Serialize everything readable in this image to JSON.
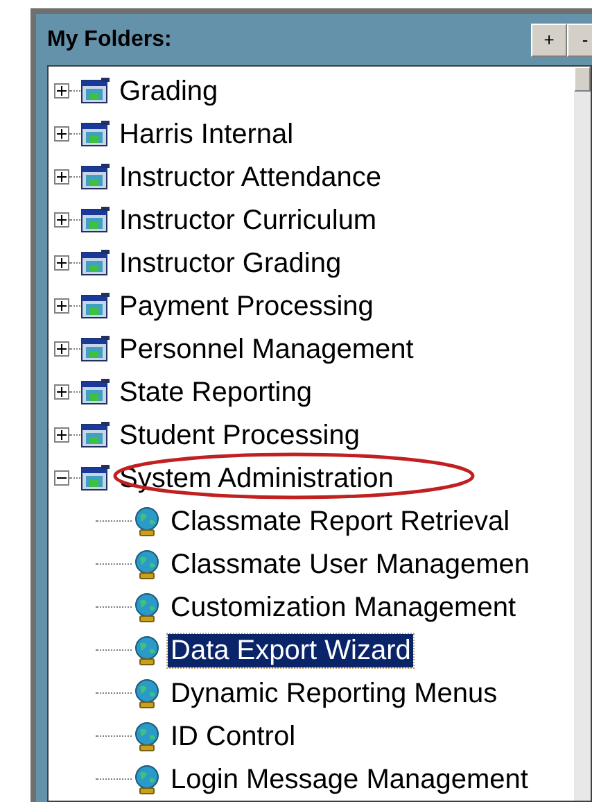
{
  "panel": {
    "title": "My Folders:",
    "buttons": [
      "+",
      "-"
    ]
  },
  "tree": [
    {
      "label": "Grading",
      "expanded": false
    },
    {
      "label": "Harris Internal",
      "expanded": false
    },
    {
      "label": "Instructor Attendance",
      "expanded": false
    },
    {
      "label": "Instructor Curriculum",
      "expanded": false
    },
    {
      "label": "Instructor Grading",
      "expanded": false
    },
    {
      "label": "Payment Processing",
      "expanded": false
    },
    {
      "label": "Personnel Management",
      "expanded": false
    },
    {
      "label": "State Reporting",
      "expanded": false
    },
    {
      "label": "Student Processing",
      "expanded": false
    },
    {
      "label": "System Administration",
      "expanded": true,
      "children": [
        {
          "label": "Classmate Report Retrieval",
          "selected": false
        },
        {
          "label": "Classmate User Managemen",
          "selected": false
        },
        {
          "label": "Customization Management",
          "selected": false
        },
        {
          "label": "Data Export Wizard",
          "selected": true
        },
        {
          "label": "Dynamic Reporting Menus",
          "selected": false
        },
        {
          "label": "ID Control",
          "selected": false
        },
        {
          "label": "Login Message Management",
          "selected": false
        }
      ]
    }
  ]
}
